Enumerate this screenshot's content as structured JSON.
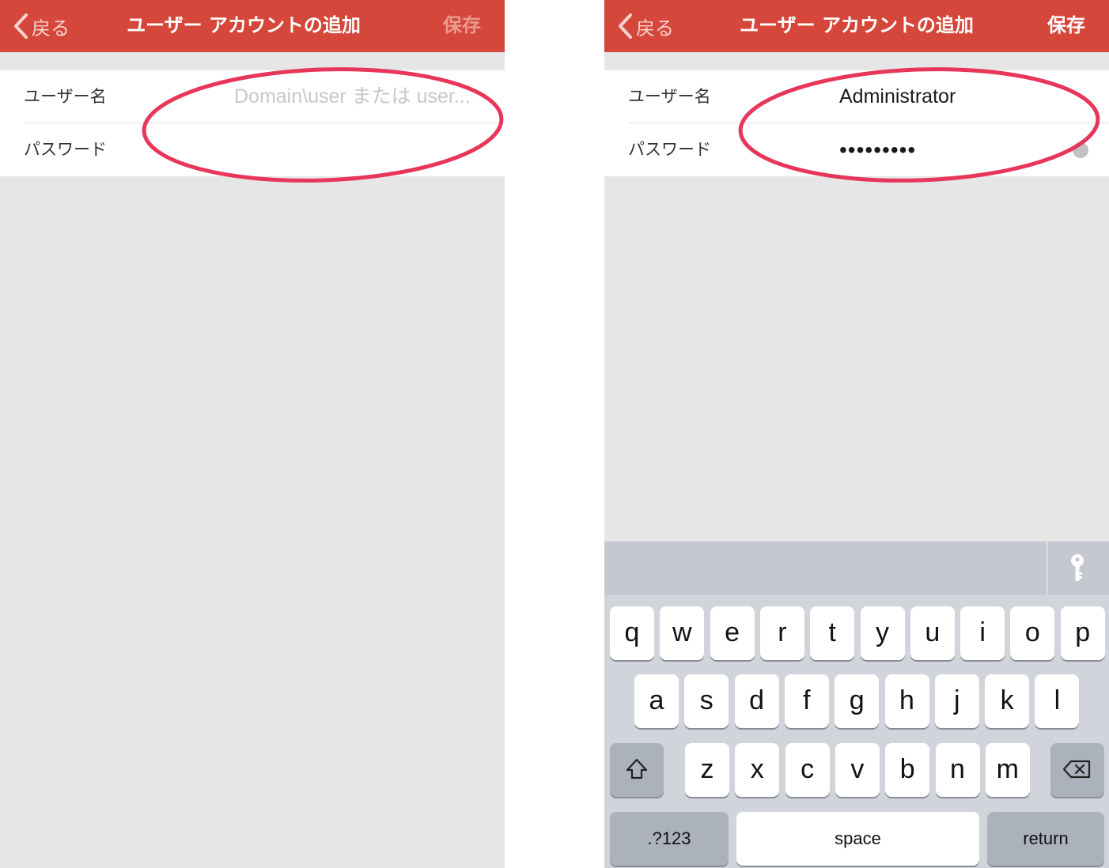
{
  "left_screen": {
    "nav": {
      "back_label": "戻る",
      "title": "ユーザー アカウントの追加",
      "save_label": "保存"
    },
    "form": {
      "username_label": "ユーザー名",
      "username_placeholder": "Domain\\user または user...",
      "password_label": "パスワード"
    }
  },
  "right_screen": {
    "nav": {
      "back_label": "戻る",
      "title": "ユーザー アカウントの追加",
      "save_label": "保存"
    },
    "form": {
      "username_label": "ユーザー名",
      "username_value": "Administrator",
      "password_label": "パスワード",
      "password_value": "•••••••••"
    },
    "keyboard": {
      "row1": [
        "q",
        "w",
        "e",
        "r",
        "t",
        "y",
        "u",
        "i",
        "o",
        "p"
      ],
      "row2": [
        "a",
        "s",
        "d",
        "f",
        "g",
        "h",
        "j",
        "k",
        "l"
      ],
      "row3": [
        "z",
        "x",
        "c",
        "v",
        "b",
        "n",
        "m"
      ],
      "numbers_label": ".?123",
      "space_label": "space",
      "return_label": "return"
    }
  },
  "colors": {
    "nav_background": "#d5473a",
    "annotation_ring": "#e8365a",
    "screen_background": "#e6e6e6",
    "keyboard_background": "#d1d4da"
  },
  "icons": [
    "chevron-left-icon",
    "key-icon",
    "shift-icon",
    "backspace-icon",
    "clear-icon"
  ]
}
